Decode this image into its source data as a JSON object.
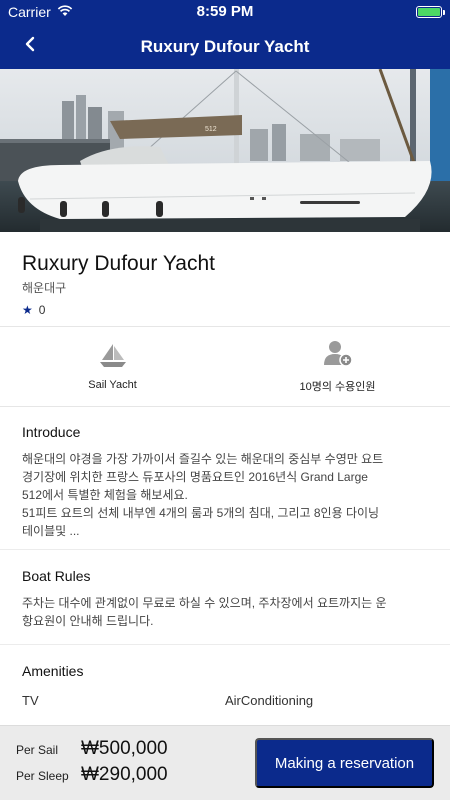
{
  "status_bar": {
    "carrier": "Carrier",
    "time": "8:59 PM"
  },
  "header": {
    "title": "Ruxury Dufour Yacht",
    "back_icon": "chevron-left-icon"
  },
  "listing": {
    "name": "Ruxury Dufour Yacht",
    "location": "해운대구",
    "rating": "0"
  },
  "specs": [
    {
      "icon": "sailboat-icon",
      "label": "Sail Yacht"
    },
    {
      "icon": "add-user-icon",
      "label": "10명의 수용인원"
    }
  ],
  "introduce": {
    "heading": "Introduce",
    "text_line1": "해운대의 야경을 가장 가까이서 즐길수 있는 해운대의 중심부 수영만 요트",
    "text_line2": "경기장에 위치한 프랑스 듀포사의 명품요트인 2016년식 Grand Large",
    "text_line3": "512에서 특별한 체험을 해보세요.",
    "text_line4": "51피트 요트의 선체 내부엔 4개의 룸과 5개의 침대, 그리고 8인용 다이닝",
    "text_line5": "테이블및 ..."
  },
  "rules": {
    "heading": "Boat Rules",
    "text_line1": "주차는 대수에 관계없이 무료로 하실 수 있으며, 주차장에서 요트까지는 운",
    "text_line2": "항요원이 안내해 드립니다."
  },
  "amenities": {
    "heading": "Amenities",
    "items": [
      "TV",
      "AirConditioning"
    ]
  },
  "footer": {
    "per_sail_label": "Per Sail",
    "per_sail_price": "₩500,000",
    "per_sleep_label": "Per Sleep",
    "per_sleep_price": "₩290,000",
    "reserve_label": "Making a reservation"
  },
  "colors": {
    "brand": "#0b2a8c",
    "battery": "#4cd964"
  }
}
